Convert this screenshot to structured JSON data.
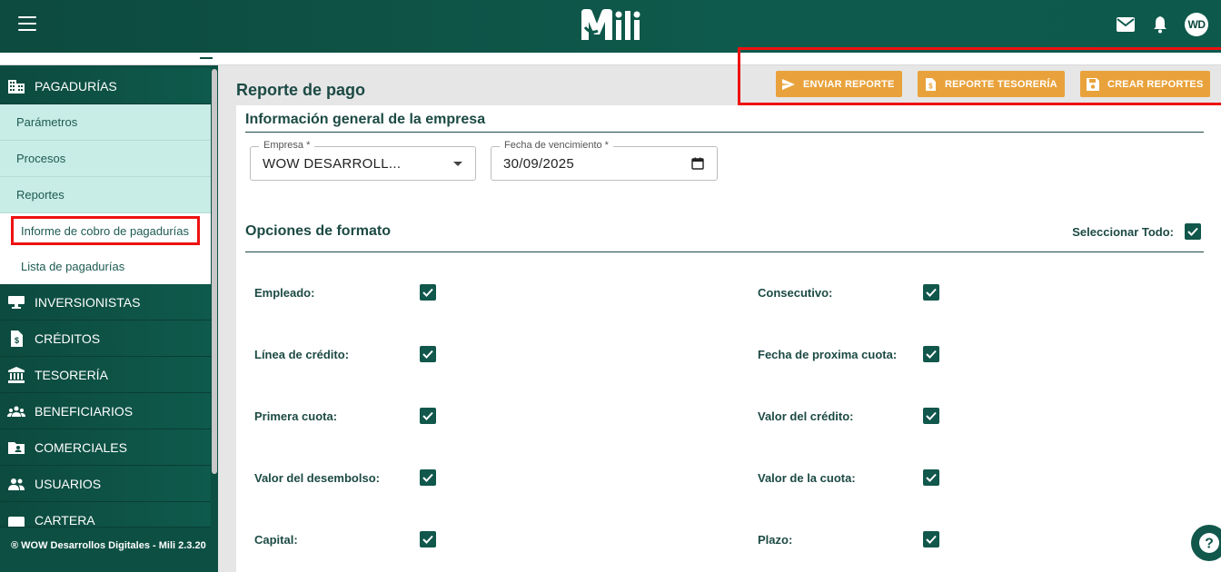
{
  "header": {
    "logo_text": "Mili",
    "avatar_initials": "WD"
  },
  "sidebar": {
    "sections": [
      {
        "label": "PAGADURÍAS",
        "icon": "building-icon"
      },
      {
        "label": "INVERSIONISTAS",
        "icon": "monitor-icon"
      },
      {
        "label": "CRÉDITOS",
        "icon": "money-document-icon"
      },
      {
        "label": "TESORERÍA",
        "icon": "bank-icon"
      },
      {
        "label": "BENEFICIARIOS",
        "icon": "group-icon"
      },
      {
        "label": "COMERCIALES",
        "icon": "folder-user-icon"
      },
      {
        "label": "USUARIOS",
        "icon": "users-icon"
      },
      {
        "label": "CARTERA",
        "icon": "wallet-icon"
      }
    ],
    "sub_items": [
      "Parámetros",
      "Procesos",
      "Reportes"
    ],
    "sub_sub_items": [
      "Informe de cobro de pagadurías",
      "Lista de pagadurías"
    ],
    "footer": "® WOW Desarrollos Digitales - Mili 2.3.20"
  },
  "main": {
    "page_title": "Reporte de pago",
    "buttons": {
      "send": "ENVIAR REPORTE",
      "treasury": "REPORTE TESORERÍA",
      "create": "CREAR REPORTES"
    },
    "general_section_title": "Información general de la empresa",
    "company_field": {
      "label": "Empresa *",
      "value": "WOW DESARROLL..."
    },
    "date_field": {
      "label": "Fecha de vencimiento *",
      "value": "30/09/2025"
    },
    "format_section_title": "Opciones de formato",
    "select_all_label": "Seleccionar Todo:",
    "options_left": [
      "Empleado:",
      "Línea de crédito:",
      "Primera cuota:",
      "Valor del desembolso:",
      "Capital:"
    ],
    "options_right": [
      "Consecutivo:",
      "Fecha de proxima cuota:",
      "Valor del crédito:",
      "Valor de la cuota:",
      "Plazo:"
    ]
  },
  "colors": {
    "primary": "#0d4f43",
    "accent": "#e9a23b",
    "highlight": "#e11111",
    "submenu_bg": "#c8ece6"
  }
}
